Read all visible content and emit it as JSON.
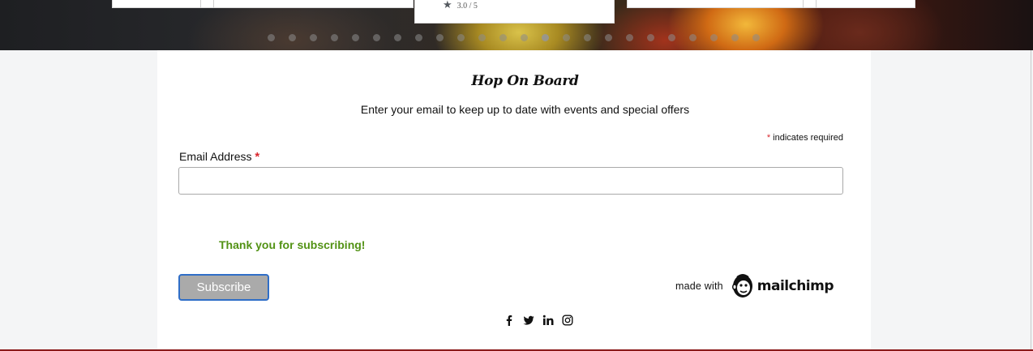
{
  "banner": {
    "rating_text": "3.0 / 5",
    "icons": {
      "rating": "star-icon"
    }
  },
  "form": {
    "title": "Hop On Board",
    "subtitle": "Enter your email to keep up to date with events and special offers",
    "required_star": "*",
    "required_note": "indicates required",
    "email_label": "Email Address",
    "email_value": "",
    "email_placeholder": "",
    "success_message": "Thank you for subscribing!",
    "subscribe_label": "Subscribe",
    "made_with": "made with",
    "brand": "mailchimp"
  },
  "social": [
    {
      "name": "facebook-icon"
    },
    {
      "name": "twitter-icon"
    },
    {
      "name": "linkedin-icon"
    },
    {
      "name": "instagram-icon"
    }
  ],
  "colors": {
    "success": "#529214",
    "required": "#d9282f",
    "button_bg": "#aaaaaa",
    "button_border": "#2f6ec7",
    "bottom_rule": "#8b1a1a"
  }
}
